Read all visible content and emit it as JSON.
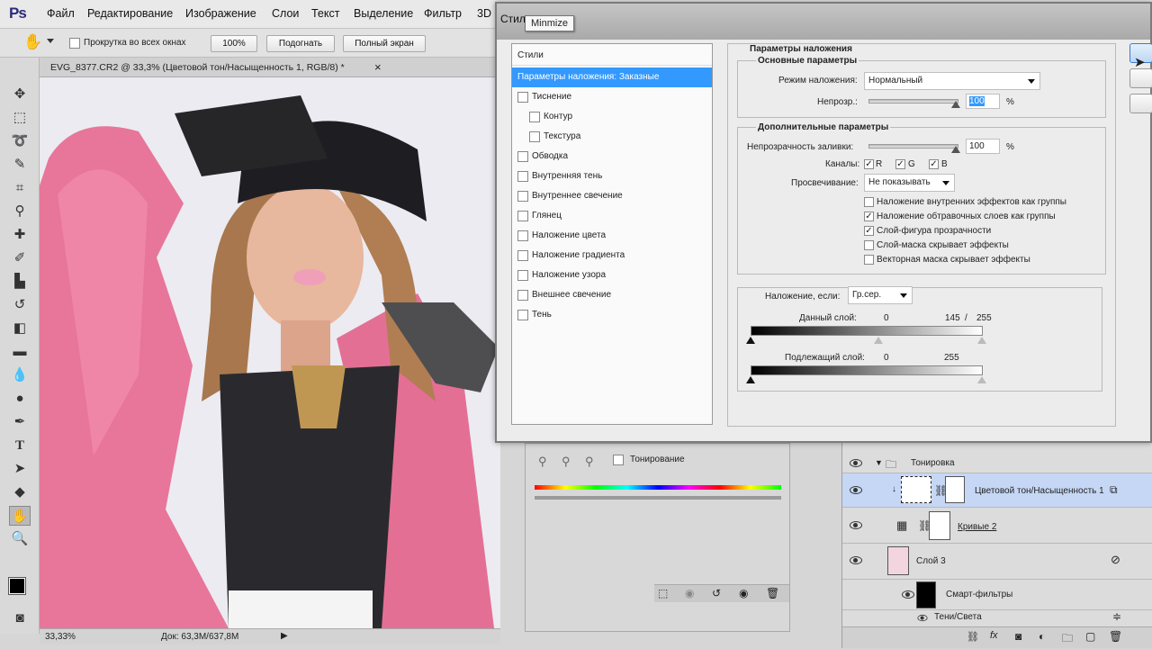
{
  "app": {
    "logo": "Ps"
  },
  "menu": [
    "Файл",
    "Редактирование",
    "Изображение",
    "Слои",
    "Текст",
    "Выделение",
    "Фильтр",
    "3D"
  ],
  "options_bar": {
    "scroll_all_label": "Прокрутка во всех окнах",
    "zoom100_label": "100%",
    "fit_label": "Подогнать",
    "fullscreen_label": "Полный экран"
  },
  "document": {
    "tab_title": "EVG_8377.CR2 @ 33,3% (Цветовой тон/Насыщенность 1, RGB/8) *",
    "tab_close": "×"
  },
  "status": {
    "zoom": "33,33%",
    "doc": "Док: 63,3M/637,8M"
  },
  "dialog": {
    "title": "Стил",
    "tooltip": "Minmize",
    "styles_header": "Стили",
    "styles_items": [
      {
        "label": "Параметры наложения: Заказные",
        "selected": true,
        "checkbox": false,
        "indent": 0
      },
      {
        "label": "Тиснение",
        "checkbox": true,
        "indent": 0
      },
      {
        "label": "Контур",
        "checkbox": true,
        "indent": 1
      },
      {
        "label": "Текстура",
        "checkbox": true,
        "indent": 1
      },
      {
        "label": "Обводка",
        "checkbox": true,
        "indent": 0
      },
      {
        "label": "Внутренняя тень",
        "checkbox": true,
        "indent": 0
      },
      {
        "label": "Внутреннее свечение",
        "checkbox": true,
        "indent": 0
      },
      {
        "label": "Глянец",
        "checkbox": true,
        "indent": 0
      },
      {
        "label": "Наложение цвета",
        "checkbox": true,
        "indent": 0
      },
      {
        "label": "Наложение градиента",
        "checkbox": true,
        "indent": 0
      },
      {
        "label": "Наложение узора",
        "checkbox": true,
        "indent": 0
      },
      {
        "label": "Внешнее свечение",
        "checkbox": true,
        "indent": 0
      },
      {
        "label": "Тень",
        "checkbox": true,
        "indent": 0
      }
    ],
    "blend_options_title": "Параметры наложения",
    "general_title": "Основные параметры",
    "blend_mode_label": "Режим наложения:",
    "blend_mode_value": "Нормальный",
    "opacity_label": "Непрозр.:",
    "opacity_value": "100",
    "percent": "%",
    "advanced_title": "Дополнительные параметры",
    "fill_opacity_label": "Непрозрачность заливки:",
    "fill_opacity_value": "100",
    "channels_label": "Каналы:",
    "channels": [
      "R",
      "G",
      "B"
    ],
    "knockout_label": "Просвечивание:",
    "knockout_value": "Не показывать",
    "options": [
      {
        "label": "Наложение внутренних эффектов как группы",
        "checked": false
      },
      {
        "label": "Наложение обтравочных слоев как группы",
        "checked": true
      },
      {
        "label": "Слой-фигура прозрачности",
        "checked": true
      },
      {
        "label": "Слой-маска скрывает эффекты",
        "checked": false
      },
      {
        "label": "Векторная маска скрывает эффекты",
        "checked": false
      }
    ],
    "blend_if_label": "Наложение, если:",
    "blend_if_value": "Гр.сер.",
    "this_layer_label": "Данный слой:",
    "this_layer_values": [
      "0",
      "145",
      "/",
      "255"
    ],
    "underlying_label": "Подлежащий слой:",
    "underlying_values": [
      "0",
      "255"
    ]
  },
  "adjustments": {
    "toning_label": "Тонирование"
  },
  "layers": [
    {
      "name": "Тонировка",
      "type": "group"
    },
    {
      "name": "Цветовой тон/Насыщенность 1",
      "type": "adjust",
      "selected": true
    },
    {
      "name": "Кривые 2",
      "type": "curves"
    },
    {
      "name": "Слой 3",
      "type": "smart"
    },
    {
      "name": "Смарт-фильтры",
      "type": "filters"
    },
    {
      "name": "Тени/Света",
      "type": "filter"
    }
  ],
  "colors": {
    "selected": "#3399ff",
    "layer_selected": "#c5d7f5",
    "ps_blue": "#2b2b7c"
  }
}
